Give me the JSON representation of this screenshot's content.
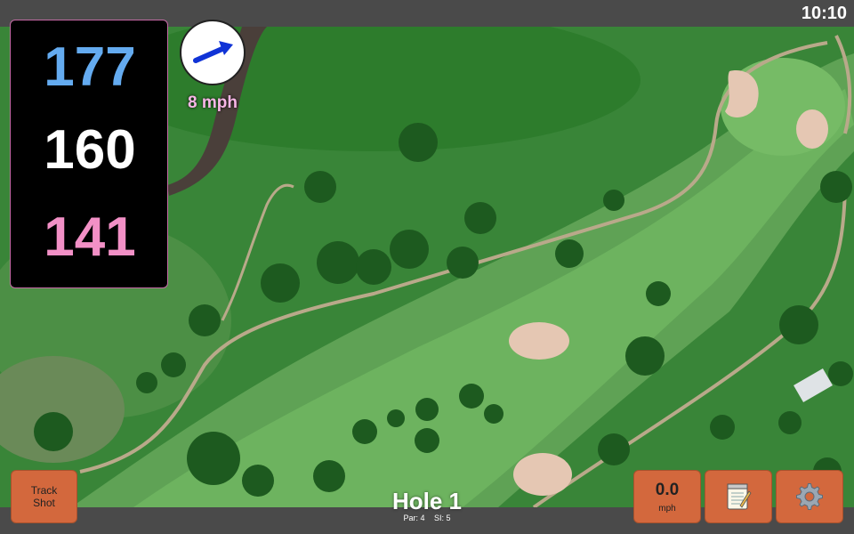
{
  "status": {
    "time": "10:10"
  },
  "distances": {
    "back": "177",
    "middle": "160",
    "front": "141"
  },
  "wind": {
    "speed": "8 mph",
    "icon": "wind-arrow-icon"
  },
  "buttons": {
    "track_shot": {
      "line1": "Track",
      "line2": "Shot"
    },
    "speed": {
      "value": "0.0",
      "unit": "mph"
    },
    "notes": {
      "icon": "notepad-icon"
    },
    "settings": {
      "icon": "gear-icon"
    }
  },
  "hole": {
    "title": "Hole 1",
    "par": "Par: 4",
    "si": "SI: 5"
  },
  "colors": {
    "back_distance": "#64abf0",
    "middle_distance": "#ffffff",
    "front_distance": "#f290c6",
    "button": "#d3683d",
    "bar": "#4a4a4a"
  }
}
